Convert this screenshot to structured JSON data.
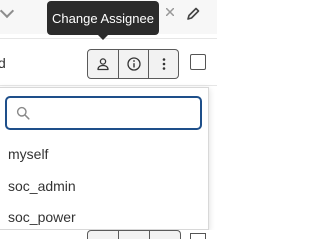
{
  "tooltip": {
    "text": "Change Assignee"
  },
  "row": {
    "text_fragment": "d"
  },
  "toolbar": {
    "buttons": [
      {
        "icon": "user-icon",
        "label": "Change Assignee"
      },
      {
        "icon": "info-icon"
      },
      {
        "icon": "more-vertical-icon"
      }
    ]
  },
  "assignee_dropdown": {
    "search": {
      "value": "",
      "placeholder": ""
    },
    "options": [
      {
        "label": "myself"
      },
      {
        "label": "soc_admin"
      },
      {
        "label": "soc_power"
      }
    ]
  },
  "colors": {
    "tooltip_bg": "#2b2b2b",
    "focus_border": "#1e4f8a",
    "button_border": "#5a5a5a"
  }
}
